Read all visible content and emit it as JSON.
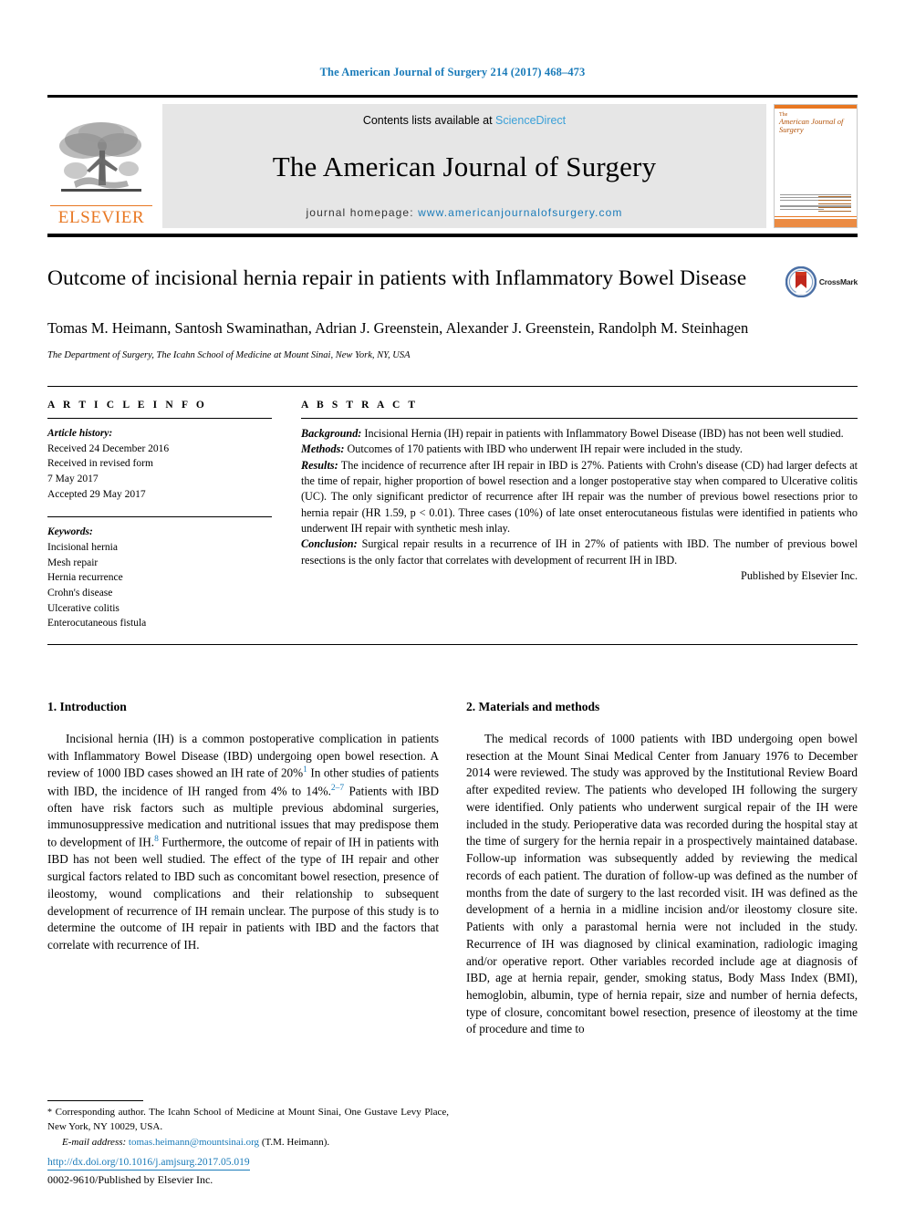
{
  "running_head": "The American Journal of Surgery 214 (2017) 468–473",
  "masthead": {
    "contents_prefix": "Contents lists available at ",
    "sciencedirect": "ScienceDirect",
    "journal_name": "The American Journal of Surgery",
    "homepage_prefix": "journal homepage: ",
    "homepage_url": "www.americanjournalofsurgery.com",
    "publisher_logo_text": "ELSEVIER",
    "cover_the": "The",
    "cover_name": "American Journal of Surgery"
  },
  "article": {
    "title": "Outcome of incisional hernia repair in patients with Inflammatory Bowel Disease",
    "authors": "Tomas M. Heimann, Santosh Swaminathan, Adrian J. Greenstein, Alexander J. Greenstein, Randolph M. Steinhagen",
    "author_star": "*",
    "affiliation": "The Department of Surgery, The Icahn School of Medicine at Mount Sinai, New York, NY, USA",
    "crossmark_label": "CrossMark"
  },
  "article_info": {
    "heading": "A R T I C L E   I N F O",
    "history_label": "Article history:",
    "history_lines": [
      "Received 24 December 2016",
      "Received in revised form",
      "7 May 2017",
      "Accepted 29 May 2017"
    ],
    "keywords_label": "Keywords:",
    "keywords": [
      "Incisional hernia",
      "Mesh repair",
      "Hernia recurrence",
      "Crohn's disease",
      "Ulcerative colitis",
      "Enterocutaneous fistula"
    ]
  },
  "abstract": {
    "heading": "A B S T R A C T",
    "background_label": "Background:",
    "background_text": " Incisional Hernia (IH) repair in patients with Inflammatory Bowel Disease (IBD) has not been well studied.",
    "methods_label": "Methods:",
    "methods_text": " Outcomes of 170 patients with IBD who underwent IH repair were included in the study.",
    "results_label": "Results:",
    "results_text": " The incidence of recurrence after IH repair in IBD is 27%. Patients with Crohn's disease (CD) had larger defects at the time of repair, higher proportion of bowel resection and a longer postoperative stay when compared to Ulcerative colitis (UC). The only significant predictor of recurrence after IH repair was the number of previous bowel resections prior to hernia repair (HR 1.59, p < 0.01). Three cases (10%) of late onset enterocutaneous fistulas were identified in patients who underwent IH repair with synthetic mesh inlay.",
    "conclusion_label": "Conclusion:",
    "conclusion_text": " Surgical repair results in a recurrence of IH in 27% of patients with IBD. The number of previous bowel resections is the only factor that correlates with development of recurrent IH in IBD.",
    "published_by": "Published by Elsevier Inc."
  },
  "sections": {
    "introduction": {
      "heading": "1. Introduction",
      "para_1a": "Incisional hernia (IH) is a common postoperative complication in patients with Inflammatory Bowel Disease (IBD) undergoing open bowel resection. A review of 1000 IBD cases showed an IH rate of 20%",
      "ref_1": "1",
      "para_1b": " In other studies of patients with IBD, the incidence of IH ranged from 4% to 14%.",
      "ref_2": "2–7",
      "para_1c": " Patients with IBD often have risk factors such as multiple previous abdominal surgeries, immunosuppressive medication and nutritional issues that may predispose them to development of IH.",
      "ref_3": "8",
      "para_1d": " Furthermore, the outcome of repair of IH in patients with IBD has not been well studied. The effect of the type of IH repair and other surgical factors related to IBD such as concomitant bowel resection, presence of ileostomy, wound complications and their relationship to subsequent development of recurrence of IH remain unclear. The purpose of this study is to determine the outcome of IH repair in patients with IBD and the factors that correlate with recurrence of IH."
    },
    "materials_and_methods": {
      "heading": "2. Materials and methods",
      "para_1": "The medical records of 1000 patients with IBD undergoing open bowel resection at the Mount Sinai Medical Center from January 1976 to December 2014 were reviewed. The study was approved by the Institutional Review Board after expedited review. The patients who developed IH following the surgery were identified. Only patients who underwent surgical repair of the IH were included in the study. Perioperative data was recorded during the hospital stay at the time of surgery for the hernia repair in a prospectively maintained database. Follow-up information was subsequently added by reviewing the medical records of each patient. The duration of follow-up was defined as the number of months from the date of surgery to the last recorded visit. IH was defined as the development of a hernia in a midline incision and/or ileostomy closure site. Patients with only a parastomal hernia were not included in the study. Recurrence of IH was diagnosed by clinical examination, radiologic imaging and/or operative report. Other variables recorded include age at diagnosis of IBD, age at hernia repair, gender, smoking status, Body Mass Index (BMI), hemoglobin, albumin, type of hernia repair, size and number of hernia defects, type of closure, concomitant bowel resection, presence of ileostomy at the time of procedure and time to"
    }
  },
  "footnote": {
    "star": "*",
    "corresponding": " Corresponding author. The Icahn School of Medicine at Mount Sinai, One Gustave Levy Place, New York, NY 10029, USA.",
    "email_label": "E-mail address:",
    "email": "tomas.heimann@mountsinai.org",
    "email_owner": "(T.M. Heimann)."
  },
  "footer": {
    "doi": "http://dx.doi.org/10.1016/j.amjsurg.2017.05.019",
    "issn": "0002-9610/Published by Elsevier Inc."
  },
  "colors": {
    "link_blue": "#1a7bb9",
    "elsevier_orange": "#e87722",
    "masthead_gray": "#e6e6e6"
  }
}
